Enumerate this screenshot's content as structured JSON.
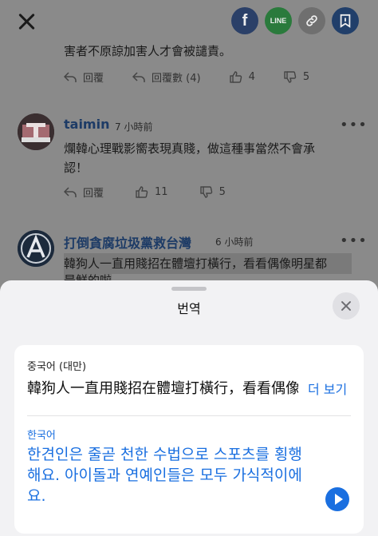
{
  "comments": [
    {
      "text_line1": "害者不原諒加害人才會被譴責。",
      "reply_label": "回覆",
      "reply_count_label": "回覆數 (4)",
      "likes": "4",
      "dislikes": "5"
    },
    {
      "username": "taimin",
      "time": "7 小時前",
      "text_line1": "爛韓心理戰影嚮表現真賤，做這種事當然不會承",
      "text_line2": "認！",
      "reply_label": "回覆",
      "likes": "11",
      "dislikes": "5"
    },
    {
      "username": "打倒貪腐垃圾黨救台灣",
      "time": "6 小時前",
      "text_line1": "韓狗人一直用賤招在體壇打橫行，看看偶像明星都",
      "text_line2": "是鮮的啦"
    }
  ],
  "translation": {
    "title": "번역",
    "source_language": "중국어 (대만)",
    "source_text": "韓狗人一直用賤招在體壇打橫行，看看偶像明星都",
    "more_label": "더 보기",
    "target_language": "한국어",
    "target_text": "한견인은 줄곧 천한 수법으로 스포츠를 횡행해요. 아이돌과 연예인들은 모두 가식적이에요."
  },
  "share": {
    "facebook": "f",
    "line": "LINE"
  }
}
